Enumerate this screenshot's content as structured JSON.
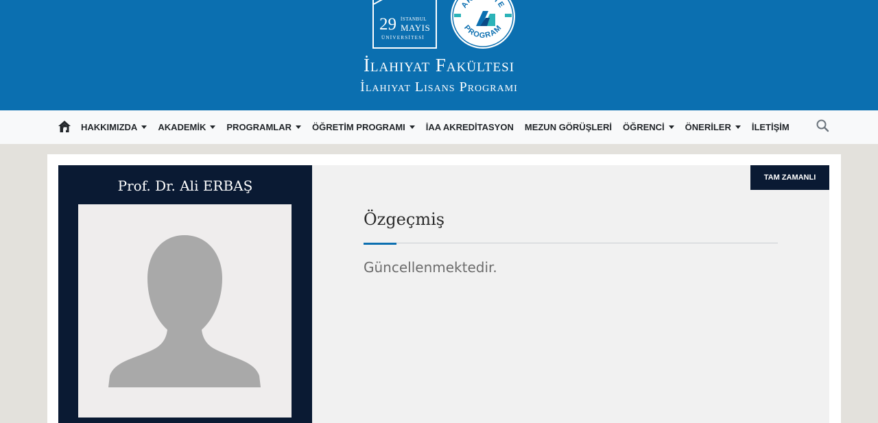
{
  "header": {
    "university_logo": {
      "number": "29",
      "line1": "İSTANBUL",
      "line2": "MAYIS",
      "line3": "ÜNİVERSİTESİ"
    },
    "accreditation_logo": {
      "text_top": "AKREDİTE",
      "text_bottom": "PROGRAM"
    },
    "faculty_title": "İlahiyat Fakültesi",
    "program_title": "İlahiyat Lisans Programı"
  },
  "nav": {
    "home_icon": "home-icon",
    "items": [
      {
        "label": "HAKKIMIZDA",
        "dropdown": true
      },
      {
        "label": "AKADEMİK",
        "dropdown": true
      },
      {
        "label": "PROGRAMLAR",
        "dropdown": true
      },
      {
        "label": "ÖĞRETİM PROGRAMI",
        "dropdown": true
      },
      {
        "label": "İAA AKREDİTASYON",
        "dropdown": false
      },
      {
        "label": "MEZUN GÖRÜŞLERİ",
        "dropdown": false
      },
      {
        "label": "ÖĞRENCİ",
        "dropdown": true
      },
      {
        "label": "ÖNERİLER",
        "dropdown": true
      },
      {
        "label": "İLETİŞİM",
        "dropdown": false
      }
    ],
    "search_icon": "search-icon"
  },
  "profile": {
    "name": "Prof. Dr. Ali ERBAŞ",
    "photo": "avatar-placeholder-icon"
  },
  "content": {
    "badge": "TAM ZAMANLI",
    "section_title": "Özgeçmiş",
    "body": "Güncellenmektedir."
  },
  "colors": {
    "header_bg": "#0b6fb0",
    "navbar_bg": "#f8f9fa",
    "profile_bg": "#0a1a33",
    "content_bg": "#f1f1f1",
    "page_bg": "#e3e1dc",
    "accent": "#0b6fb0"
  }
}
